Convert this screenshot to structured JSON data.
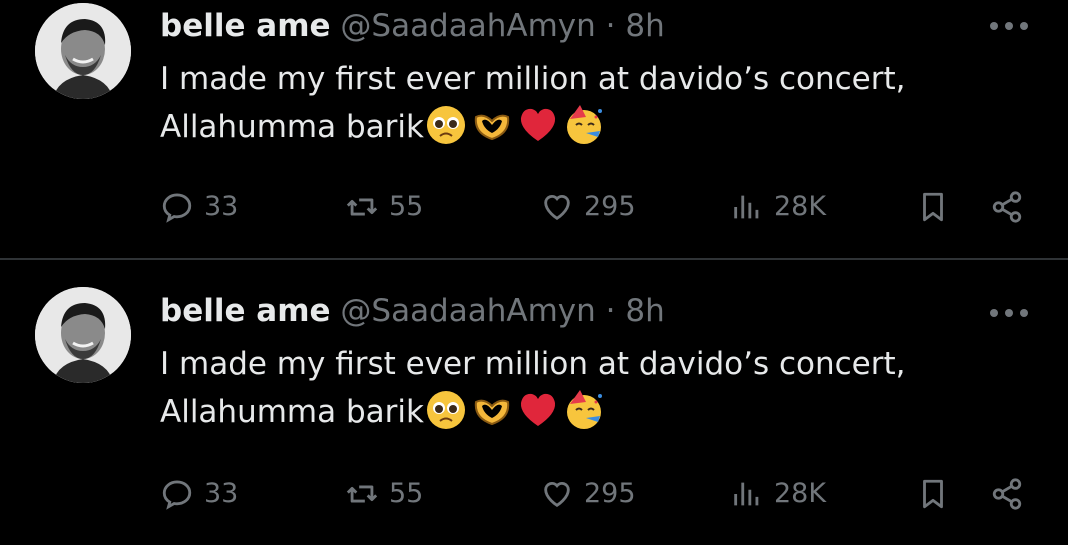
{
  "tweets": [
    {
      "name": "belle ame",
      "handle": "@SaadaahAmyn",
      "separator": "·",
      "time": "8h",
      "line1": "I made my first ever million at davido’s concert,",
      "line2": "Allahumma barik",
      "emojis": [
        "pleading-face",
        "heart-hands",
        "red-heart",
        "partying-face"
      ],
      "replies": "33",
      "reposts": "55",
      "likes": "295",
      "views": "28K"
    },
    {
      "name": "belle ame",
      "handle": "@SaadaahAmyn",
      "separator": "·",
      "time": "8h",
      "line1": "I made my first ever million at davido’s concert,",
      "line2": "Allahumma barik",
      "emojis": [
        "pleading-face",
        "heart-hands",
        "red-heart",
        "partying-face"
      ],
      "replies": "33",
      "reposts": "55",
      "likes": "295",
      "views": "28K"
    }
  ],
  "colors": {
    "background": "#000000",
    "text": "#e7e9ea",
    "muted": "#71767b",
    "divider": "#2f3336"
  }
}
